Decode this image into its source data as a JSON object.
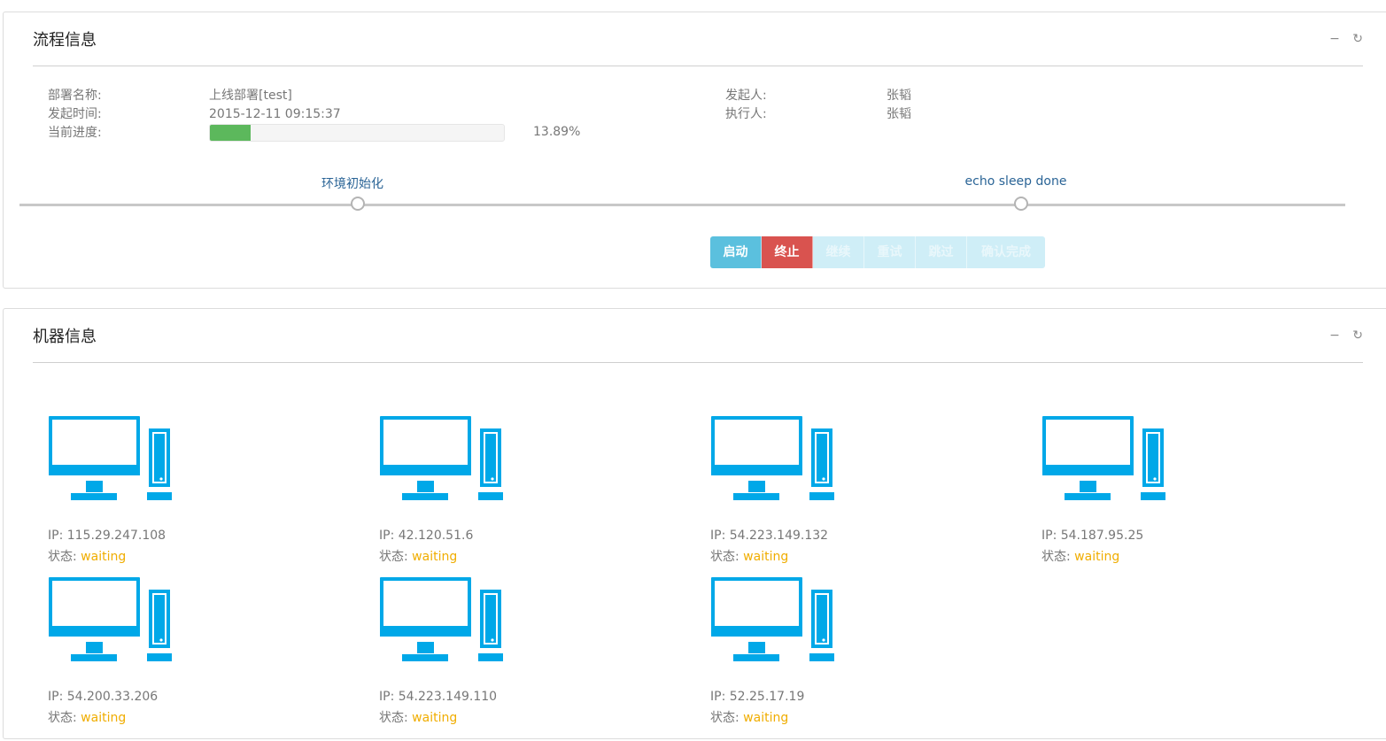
{
  "process_panel": {
    "title": "流程信息",
    "tools": {
      "minimize": "−",
      "refresh": "↻"
    },
    "deploy_name_label": "部署名称:",
    "deploy_name_value": "上线部署[test]",
    "start_time_label": "发起时间:",
    "start_time_value": "2015-12-11 09:15:37",
    "progress_label": "当前进度:",
    "progress_percent": 13.89,
    "progress_text": "13.89%",
    "initiator_label": "发起人:",
    "initiator_value": "张韬",
    "executor_label": "执行人:",
    "executor_value": "张韬",
    "steps": [
      "环境初始化",
      "echo sleep done"
    ],
    "buttons": {
      "start": "启动",
      "stop": "终止",
      "continue": "继续",
      "retry": "重试",
      "skip": "跳过",
      "confirm": "确认完成"
    },
    "colors": {
      "progress": "#5cb85c",
      "start": "#5bc0de",
      "stop": "#d9534f"
    }
  },
  "machines_panel": {
    "title": "机器信息",
    "tools": {
      "minimize": "−",
      "refresh": "↻"
    },
    "status_label": "状态:",
    "machines": [
      {
        "ip": "IP: 115.29.247.108",
        "status": "waiting"
      },
      {
        "ip": "IP: 42.120.51.6",
        "status": "waiting"
      },
      {
        "ip": "IP: 54.223.149.132",
        "status": "waiting"
      },
      {
        "ip": "IP: 54.187.95.25",
        "status": "waiting"
      },
      {
        "ip": "IP: 54.200.33.206",
        "status": "waiting"
      },
      {
        "ip": "IP: 54.223.149.110",
        "status": "waiting"
      },
      {
        "ip": "IP: 52.25.17.19",
        "status": "waiting"
      }
    ],
    "icon": "computer-icon",
    "colors": {
      "icon": "#00a8e8",
      "waiting": "#f0ad00"
    }
  }
}
